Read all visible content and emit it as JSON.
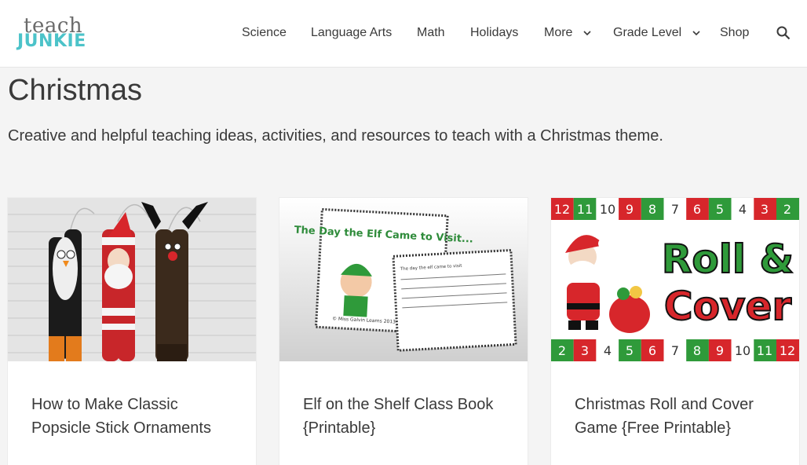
{
  "header": {
    "logo_top": "teach",
    "logo_bottom": "JUNKIE",
    "nav": [
      {
        "label": "Science"
      },
      {
        "label": "Language Arts"
      },
      {
        "label": "Math"
      },
      {
        "label": "Holidays"
      },
      {
        "label": "More"
      },
      {
        "label": "Grade Level"
      },
      {
        "label": "Shop"
      }
    ],
    "search_icon": "search-icon"
  },
  "page": {
    "title": "Christmas",
    "description": "Creative and helpful teaching ideas, activities, and resources to teach with a Christmas theme."
  },
  "cards": [
    {
      "title": "How to Make Classic Popsicle Stick Ornaments"
    },
    {
      "title": "Elf on the Shelf Class Book {Printable}",
      "image_heading": "The Day the Elf Came to Visit...",
      "image_subtext": "The day the elf came to visit",
      "image_credit": "© Miss Galvin Learns 2013"
    },
    {
      "title": "Christmas Roll and Cover Game {Free Printable}",
      "image_heading_1": "Roll &",
      "image_heading_2": "Cover",
      "top_numbers": [
        "12",
        "11",
        "10",
        "9",
        "8",
        "7",
        "6",
        "5",
        "4",
        "3",
        "2"
      ],
      "bottom_numbers": [
        "2",
        "3",
        "4",
        "5",
        "6",
        "7",
        "8",
        "9",
        "10",
        "11",
        "12"
      ]
    }
  ],
  "colors": {
    "accent": "#4cc3c9",
    "text": "#3a3a3a",
    "christmas_red": "#d7262b",
    "christmas_green": "#2f9a3a"
  }
}
